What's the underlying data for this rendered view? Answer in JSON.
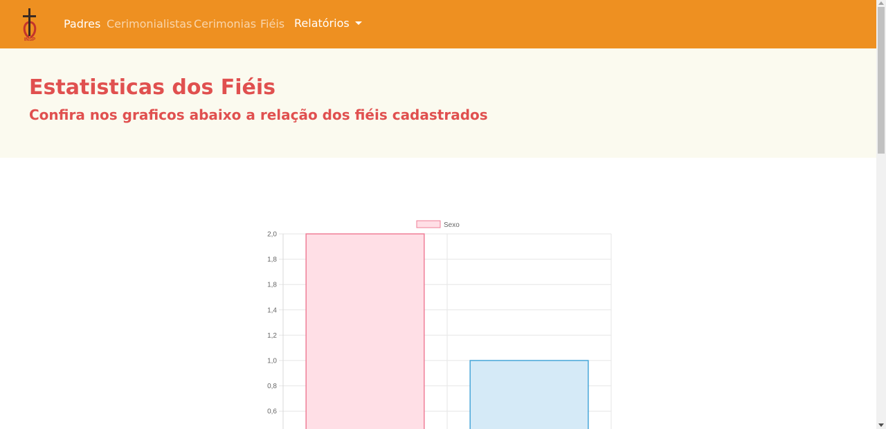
{
  "nav": {
    "logo_text": "INSP",
    "items": [
      {
        "label": "Padres",
        "active": true
      },
      {
        "label": "Cerimonialistas",
        "active": false
      },
      {
        "label": "Cerimonias",
        "active": false
      },
      {
        "label": "Fiéis",
        "active": false
      }
    ],
    "dropdown_label": "Relatórios"
  },
  "hero": {
    "title": "Estatisticas dos Fiéis",
    "subtitle": "Confira nos graficos abaixo a relação dos fiéis cadastrados"
  },
  "colors": {
    "navbar": "#ee9021",
    "hero_bg": "#fbfaef",
    "heading": "#e0504f",
    "bar1_fill": "#ffdfe6",
    "bar1_border": "#ef7e96",
    "bar2_fill": "#d5eaf7",
    "bar2_border": "#46a6d8"
  },
  "chart_data": {
    "type": "bar",
    "legend": [
      "Sexo"
    ],
    "legend_position": "top",
    "series": [
      {
        "name": "Sexo",
        "values": [
          2,
          1
        ]
      }
    ],
    "ylim": [
      0.6,
      2.0
    ],
    "yticks": [
      "2,0",
      "1,8",
      "1,8",
      "1,4",
      "1,2",
      "1,0",
      "0,8",
      "0,6"
    ],
    "ytick_values": [
      2.0,
      1.8,
      1.6,
      1.4,
      1.2,
      1.0,
      0.8,
      0.6
    ],
    "grid": true
  }
}
